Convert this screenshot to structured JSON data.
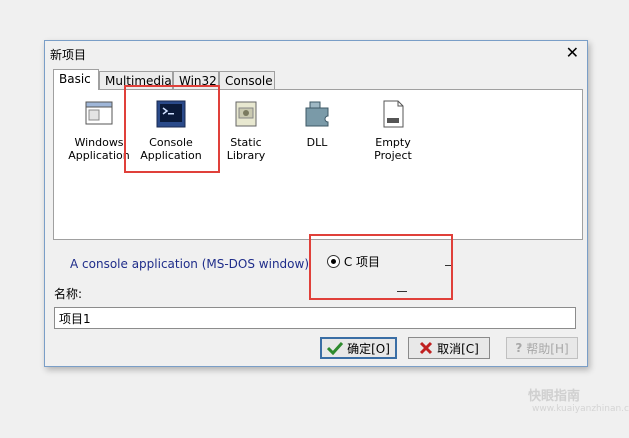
{
  "window": {
    "title": "新项目",
    "close_glyph": "✕"
  },
  "tabs": [
    {
      "label": "Basic",
      "active": true
    },
    {
      "label": "Multimedia",
      "active": false
    },
    {
      "label": "Win32",
      "active": false
    },
    {
      "label": "Console",
      "active": false
    }
  ],
  "templates": [
    {
      "label": "Windows\nApplication",
      "icon": "window-icon"
    },
    {
      "label": "Console\nApplication",
      "icon": "console-icon",
      "selected": true
    },
    {
      "label": "Static Library",
      "icon": "library-icon"
    },
    {
      "label": "DLL",
      "icon": "dll-icon"
    },
    {
      "label": "Empty Project",
      "icon": "empty-project-icon"
    }
  ],
  "description": "A console application (MS-DOS window)",
  "language_option": {
    "label": "C 项目",
    "selected": true
  },
  "name_field": {
    "label": "名称:",
    "value": "项目1"
  },
  "buttons": {
    "ok": "确定[O]",
    "cancel": "取消[C]",
    "help": "帮助[H]"
  },
  "watermark": {
    "text": "快眼指南",
    "sub": "www.kuaiyanzhinan.com"
  },
  "colors": {
    "highlight": "#e0403a",
    "desc_text": "#1f2d8a",
    "ok_check": "#2e8b2e",
    "cancel_x": "#c02020"
  }
}
